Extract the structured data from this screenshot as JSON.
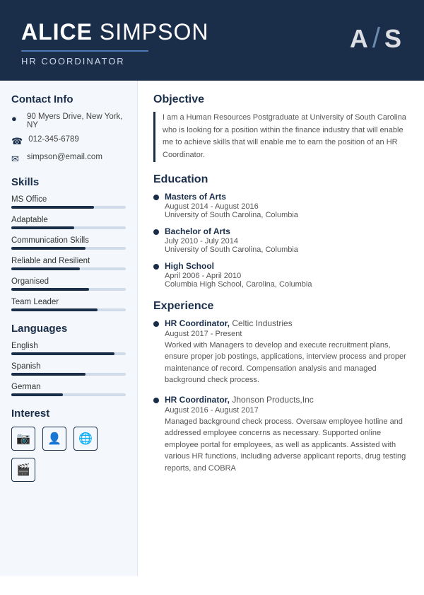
{
  "header": {
    "first_name": "ALICE",
    "last_name": " SIMPSON",
    "title": "HR COORDINATOR",
    "initial_a": "A",
    "initial_s": "S"
  },
  "contact": {
    "section_title": "Contact Info",
    "address": "90 Myers Drive, New York, NY",
    "phone": "012-345-6789",
    "email": "simpson@email.com"
  },
  "skills": {
    "section_title": "Skills",
    "items": [
      {
        "label": "MS Office",
        "percent": 72
      },
      {
        "label": "Adaptable",
        "percent": 55
      },
      {
        "label": "Communication Skills",
        "percent": 65
      },
      {
        "label": "Reliable and Resilient",
        "percent": 60
      },
      {
        "label": "Organised",
        "percent": 68
      },
      {
        "label": "Team Leader",
        "percent": 75
      }
    ]
  },
  "languages": {
    "section_title": "Languages",
    "items": [
      {
        "label": "English",
        "percent": 90
      },
      {
        "label": "Spanish",
        "percent": 65
      },
      {
        "label": "German",
        "percent": 45
      }
    ]
  },
  "interest": {
    "section_title": "Interest",
    "icons": [
      {
        "name": "camera-icon",
        "symbol": "📷"
      },
      {
        "name": "person-icon",
        "symbol": "👤"
      },
      {
        "name": "globe-icon",
        "symbol": "🌐"
      },
      {
        "name": "video-icon",
        "symbol": "🎬"
      }
    ]
  },
  "objective": {
    "section_title": "Objective",
    "text": "I am a Human Resources Postgraduate at University of South Carolina who is looking for a position within the finance industry that will enable me to achieve skills that will enable me to earn the position of an HR Coordinator."
  },
  "education": {
    "section_title": "Education",
    "items": [
      {
        "degree": "Masters of Arts",
        "dates": "August 2014 - August 2016",
        "school": "University of South Carolina, Columbia"
      },
      {
        "degree": "Bachelor of Arts",
        "dates": "July 2010 - July 2014",
        "school": "University of South Carolina, Columbia"
      },
      {
        "degree": "High School",
        "dates": "April 2006 - April 2010",
        "school": "Columbia High School, Carolina, Columbia"
      }
    ]
  },
  "experience": {
    "section_title": "Experience",
    "items": [
      {
        "title": "HR Coordinator",
        "company": "Celtic Industries",
        "dates": "August 2017 - Present",
        "description": "Worked with Managers to develop and execute recruitment plans, ensure proper job postings, applications, interview process and proper maintenance of record. Compensation analysis and managed background check process."
      },
      {
        "title": "HR Coordinator",
        "company": "Jhonson Products,Inc",
        "dates": "August 2016 - August 2017",
        "description": "Managed background check process. Oversaw employee hotline and addressed employee concerns as necessary. Supported online employee portal for employees, as well as applicants. Assisted with various HR functions, including adverse applicant reports, drug testing reports, and COBRA"
      }
    ]
  }
}
